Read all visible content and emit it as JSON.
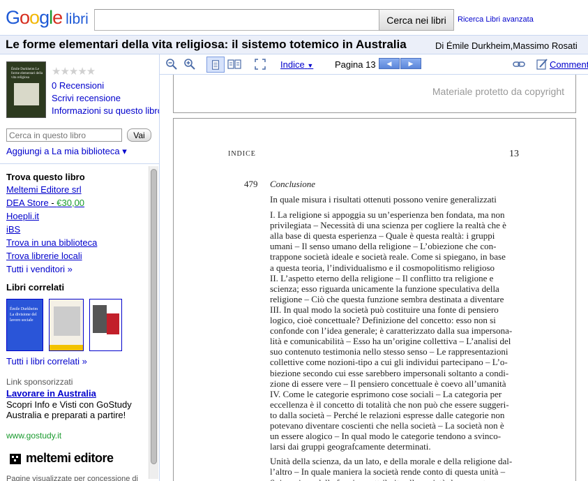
{
  "header": {
    "logo_text": "Google",
    "logo_suffix": "libri",
    "search_value": "",
    "search_button": "Cerca nei libri",
    "advanced_link": "Ricerca Libri avanzata"
  },
  "book": {
    "title": "Le forme elementari della vita religiosa: il sistemo totemico in Australia",
    "authors_prefix": "Di",
    "authors": "Émile Durkheim,Massimo Rosati"
  },
  "sidebar": {
    "cover_text": "Émile Durkheim Le forme elementari della vita religiosa",
    "stars": "★★★★★",
    "reviews_link": "0 Recensioni",
    "write_review_link": "Scrivi recensione",
    "info_link": "Informazioni su questo libro",
    "book_search_placeholder": "Cerca in questo libro",
    "go_button": "Vai",
    "add_library": "Aggiungi a La mia biblioteca ▾",
    "find_title": "Trova questo libro",
    "vendors": [
      {
        "label": "Meltemi Editore srl"
      },
      {
        "label": "DEA Store",
        "sep": " - ",
        "price": "€30,00"
      },
      {
        "label": "Hoepli.it"
      },
      {
        "label": "iBS"
      },
      {
        "label": "Trova in una biblioteca"
      },
      {
        "label": "Trova librerie locali"
      }
    ],
    "all_vendors": "Tutti i venditori »",
    "related_title": "Libri correlati",
    "related_1_text": "Émile Durkheim La divisione del lavoro sociale",
    "all_related": "Tutti i libri correlati »",
    "sponsored_label": "Link sponsorizzati",
    "sponsor_link": "Lavorare in Australia",
    "sponsor_text": "Scopri Info e Visti con GoStudy Australia e preparati a partire!",
    "sponsor_url": "www.gostudy.it",
    "publisher_logo": "meltemi editore",
    "footnote": "Pagine visualizzate per concessione di"
  },
  "toolbar": {
    "index_label": "Indice",
    "page_label": "Pagina 13",
    "comment_label": "Comment"
  },
  "viewer": {
    "copyright": "Materiale protetto da copyright",
    "running_head": "INDICE",
    "page_number": "13",
    "entry_number": "479",
    "entry_title": "Conclusione",
    "lines": [
      "In quale misura i risultati ottenuti possono venire generalizzati",
      "I. La religione si appoggia su un’esperienza ben fondata, ma non",
      "privilegiata – Necessità di una scienza per cogliere la realtà che è",
      "alla base di questa esperienza – Quale è questa realtà: i gruppi",
      "umani – Il senso umano della religione – L’obiezione che con-",
      "trappone società ideale e società reale. Come si spiegano, in base",
      "a questa teoria, l’individualismo e il cosmopolitismo religioso",
      "II. L’aspetto eterno della religione – Il conflitto tra religione e",
      "scienza; esso riguarda unicamente la funzione speculativa della",
      "religione – Ciò che questa funzione sembra destinata a diventare",
      "III. In qual modo la società può costituire una fonte di pensiero",
      "logico, cioè concettuale? Definizione del concetto: esso non si",
      "confonde con l’idea generale; è caratterizzato dalla sua impersona-",
      "lità e comunicabilità – Esso ha un’origine collettiva – L’analisi del",
      "suo contenuto testimonia nello stesso senso – Le rappresentazioni",
      "collettive come nozioni-tipo a cui gli individui partecipano – L’o-",
      "biezione secondo cui esse sarebbero impersonali soltanto a condi-",
      "zione di essere vere – Il pensiero concettuale è coevo all’umanità",
      "IV. Come le categorie esprimono cose sociali – La categoria per",
      "eccellenza è il concetto di totalità che non può che essere suggeri-",
      "to dalla società – Perché le relazioni espresse dalle categorie non",
      "potevano diventare coscienti che nella società – La società non è",
      "un essere alogico – In qual modo le categorie tendono a svinco-",
      "larsi dai gruppi geografcamente determinati.",
      "Unità della scienza, da un lato, e della morale e della religione dal-",
      "l’altro – In quale maniera la società rende conto di questa unità –",
      "Spiegazione della funzione attribuita alla società: la sua potenza"
    ]
  }
}
